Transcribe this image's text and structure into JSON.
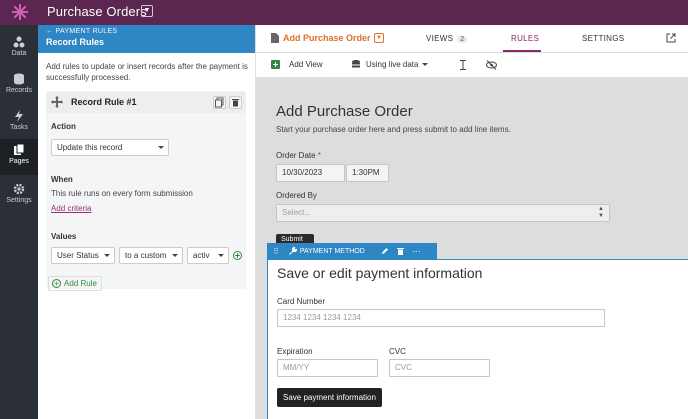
{
  "app": {
    "title": "Purchase Orders"
  },
  "rail": {
    "items": [
      {
        "label": "Data",
        "icon": "data-icon"
      },
      {
        "label": "Records",
        "icon": "records-icon"
      },
      {
        "label": "Tasks",
        "icon": "tasks-icon"
      },
      {
        "label": "Pages",
        "icon": "pages-icon",
        "active": true
      },
      {
        "label": "Settings",
        "icon": "settings-icon"
      }
    ]
  },
  "panel": {
    "crumb": "PAYMENT RULES",
    "title": "Record Rules",
    "description": "Add rules to update or insert records after the payment is successfully processed.",
    "rule": {
      "name": "Record Rule #1",
      "action_label": "Action",
      "action_value": "Update this record",
      "when_label": "When",
      "when_text": "This rule runs on every form submission",
      "add_criteria": "Add criteria",
      "values_label": "Values",
      "value_field": "User Status",
      "value_mode": "to a custom",
      "value_value": "activ"
    },
    "add_rule": "Add Rule"
  },
  "header": {
    "page_name": "Add Purchase Order",
    "tabs": [
      {
        "label": "VIEWS",
        "badge": "2"
      },
      {
        "label": "RULES",
        "active": true
      },
      {
        "label": "SETTINGS"
      }
    ]
  },
  "toolbar": {
    "add_view": "Add View",
    "data_source": "Using live data"
  },
  "form": {
    "title": "Add Purchase Order",
    "description": "Start your purchase order here and press submit to add line items.",
    "order_date_label": "Order Date",
    "required_mark": "*",
    "order_date_value": "10/30/2023",
    "order_time_value": "1:30PM",
    "ordered_by_label": "Ordered By",
    "ordered_by_placeholder": "Select...",
    "submit_label": "Submit"
  },
  "payment": {
    "bar_label": "PAYMENT METHOD",
    "title": "Save or edit payment information",
    "card_label": "Card Number",
    "card_placeholder": "1234 1234 1234 1234",
    "exp_label": "Expiration",
    "exp_placeholder": "MM/YY",
    "cvc_label": "CVC",
    "cvc_placeholder": "CVC",
    "save_label": "Save payment information"
  },
  "colors": {
    "topbar": "#5b2750",
    "rail": "#2b3036",
    "accent_blue": "#2f86c5",
    "accent_orange": "#e06f2c",
    "accent_purple": "#8a2766",
    "add_green": "#2f8a3f"
  }
}
